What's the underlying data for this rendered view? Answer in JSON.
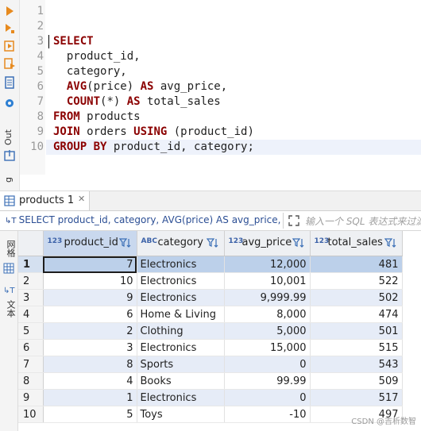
{
  "sidebar": {
    "output_label": "Out",
    "log_label": "g",
    "grid_label": "网格",
    "text_label": "文本"
  },
  "editor": {
    "line_numbers": [
      "1",
      "2",
      "3",
      "4",
      "5",
      "6",
      "7",
      "8",
      "9",
      "10"
    ],
    "lines": [
      [],
      [],
      [
        {
          "t": "SELECT",
          "c": "kw"
        }
      ],
      [
        {
          "t": "  product_id,",
          "c": ""
        }
      ],
      [
        {
          "t": "  category,",
          "c": ""
        }
      ],
      [
        {
          "t": "  ",
          "c": ""
        },
        {
          "t": "AVG",
          "c": "kw"
        },
        {
          "t": "(price) ",
          "c": ""
        },
        {
          "t": "AS",
          "c": "kw"
        },
        {
          "t": " avg_price,",
          "c": ""
        }
      ],
      [
        {
          "t": "  ",
          "c": ""
        },
        {
          "t": "COUNT",
          "c": "kw"
        },
        {
          "t": "(*) ",
          "c": ""
        },
        {
          "t": "AS",
          "c": "kw"
        },
        {
          "t": " total_sales",
          "c": ""
        }
      ],
      [
        {
          "t": "FROM",
          "c": "kw"
        },
        {
          "t": " products",
          "c": ""
        }
      ],
      [
        {
          "t": "JOIN",
          "c": "kw"
        },
        {
          "t": " orders ",
          "c": ""
        },
        {
          "t": "USING",
          "c": "kw"
        },
        {
          "t": " (product_id)",
          "c": ""
        }
      ],
      [
        {
          "t": "GROUP BY",
          "c": "kw"
        },
        {
          "t": " product_id, category;",
          "c": ""
        }
      ]
    ]
  },
  "results": {
    "tab_label": "products 1",
    "sql_preview": "SELECT product_id, category, AVG(price) AS avg_price, C",
    "filter_placeholder": "输入一个 SQL 表达式来过滤",
    "columns": [
      {
        "type": "123",
        "name": "product_id"
      },
      {
        "type": "ABC",
        "name": "category"
      },
      {
        "type": "123",
        "name": "avg_price"
      },
      {
        "type": "123",
        "name": "total_sales"
      }
    ],
    "rows": [
      [
        "1",
        "7",
        "Electronics",
        "12,000",
        "481"
      ],
      [
        "2",
        "10",
        "Electronics",
        "10,001",
        "522"
      ],
      [
        "3",
        "9",
        "Electronics",
        "9,999.99",
        "502"
      ],
      [
        "4",
        "6",
        "Home & Living",
        "8,000",
        "474"
      ],
      [
        "5",
        "2",
        "Clothing",
        "5,000",
        "501"
      ],
      [
        "6",
        "3",
        "Electronics",
        "15,000",
        "515"
      ],
      [
        "7",
        "8",
        "Sports",
        "0",
        "543"
      ],
      [
        "8",
        "4",
        "Books",
        "99.99",
        "509"
      ],
      [
        "9",
        "1",
        "Electronics",
        "0",
        "517"
      ],
      [
        "10",
        "5",
        "Toys",
        "-10",
        "497"
      ]
    ]
  },
  "watermark": "CSDN @吉析数智",
  "colors": {
    "keyword": "#8b0000",
    "selected_row": "#bcd0ea",
    "alt_row": "#e6ecf7"
  }
}
